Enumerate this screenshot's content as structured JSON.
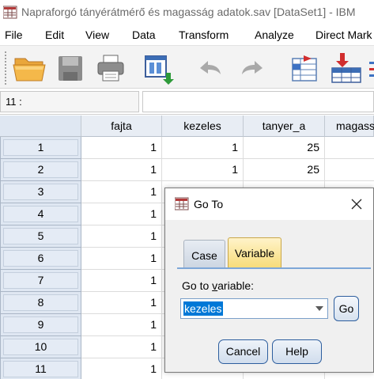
{
  "window": {
    "title": "Napraforgó tányérátmérő és magasság adatok.sav [DataSet1] - IBM"
  },
  "menu": [
    "File",
    "Edit",
    "View",
    "Data",
    "Transform",
    "Analyze",
    "Direct Mark"
  ],
  "toolbar": {
    "buttons": [
      "open-folder-icon",
      "save-icon",
      "print-icon",
      "dialog-recall-icon",
      "undo-icon",
      "redo-icon",
      "goto-case-icon",
      "goto-variable-icon"
    ]
  },
  "cell_bar": {
    "reference": "11 :",
    "value": ""
  },
  "grid": {
    "columns": [
      "fajta",
      "kezeles",
      "tanyer_a",
      "magass"
    ],
    "rows": [
      {
        "row": "1",
        "fajta": "1",
        "kezeles": "1",
        "tanyer_a": "25"
      },
      {
        "row": "2",
        "fajta": "1",
        "kezeles": "1",
        "tanyer_a": "25"
      },
      {
        "row": "3",
        "fajta": "1",
        "kezeles": "",
        "tanyer_a": ""
      },
      {
        "row": "4",
        "fajta": "1",
        "kezeles": "",
        "tanyer_a": ""
      },
      {
        "row": "5",
        "fajta": "1",
        "kezeles": "",
        "tanyer_a": ""
      },
      {
        "row": "6",
        "fajta": "1",
        "kezeles": "",
        "tanyer_a": ""
      },
      {
        "row": "7",
        "fajta": "1",
        "kezeles": "",
        "tanyer_a": ""
      },
      {
        "row": "8",
        "fajta": "1",
        "kezeles": "",
        "tanyer_a": ""
      },
      {
        "row": "9",
        "fajta": "1",
        "kezeles": "",
        "tanyer_a": ""
      },
      {
        "row": "10",
        "fajta": "1",
        "kezeles": "",
        "tanyer_a": ""
      },
      {
        "row": "11",
        "fajta": "1",
        "kezeles": "",
        "tanyer_a": ""
      }
    ]
  },
  "dialog": {
    "title": "Go To",
    "tabs": [
      {
        "label": "Case",
        "active": false
      },
      {
        "label": "Variable",
        "active": true
      }
    ],
    "goto_label": "Go to variable:",
    "selected_variable": "kezeles",
    "go_label": "Go",
    "cancel_label": "Cancel",
    "help_label": "Help"
  },
  "colors": {
    "selection": "#0078d7",
    "active_tab": "#f7dc7a",
    "header_bg": "#e8edf4"
  }
}
